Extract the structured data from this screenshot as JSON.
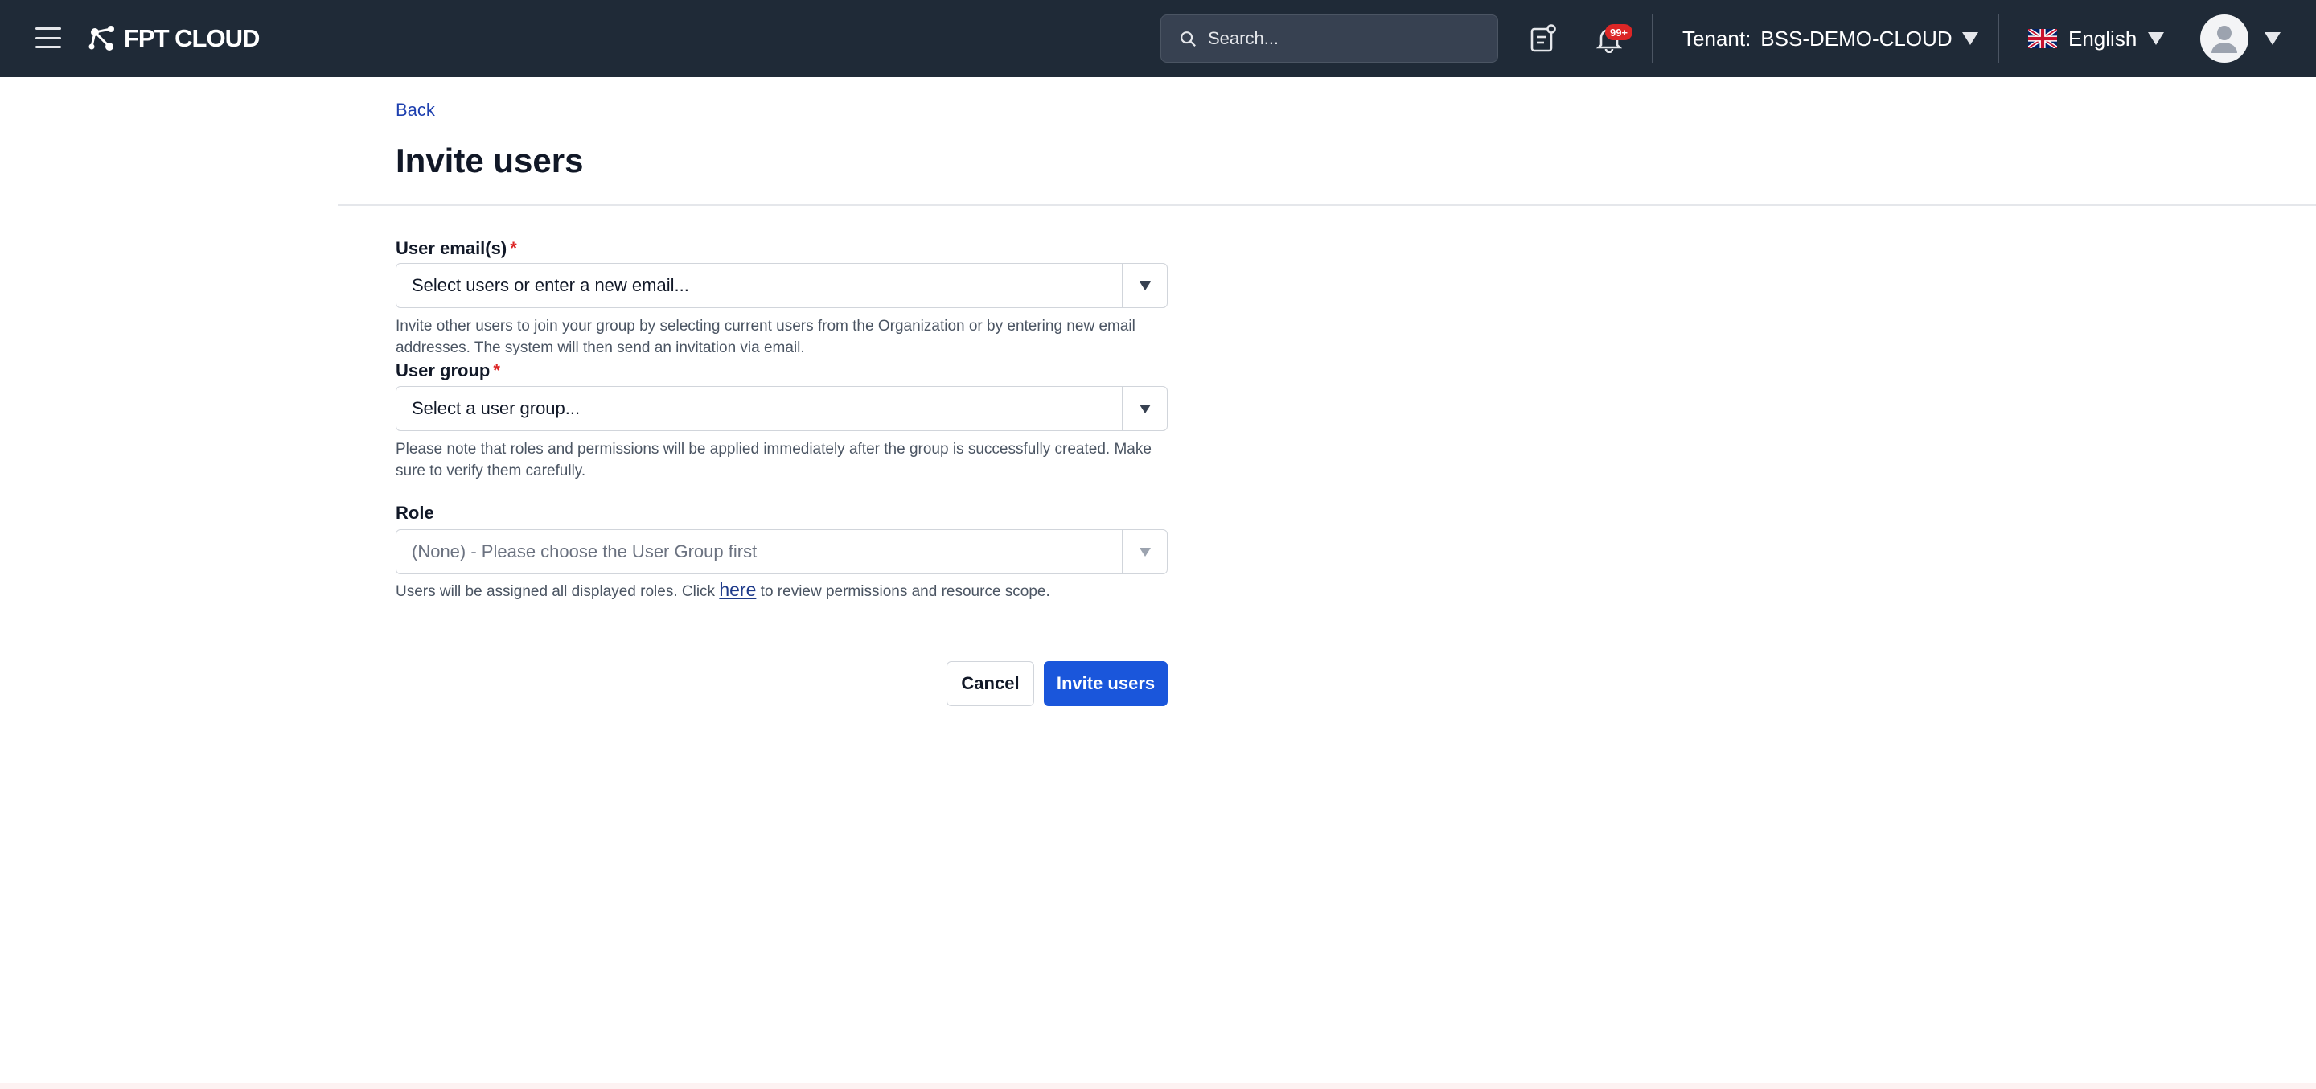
{
  "topbar": {
    "logo_text": "FPT CLOUD",
    "search_placeholder": "Search...",
    "notification_badge": "99+",
    "tenant_label": "Tenant:",
    "tenant_value": "BSS-DEMO-CLOUD",
    "language": "English",
    "icons": [
      "menu-icon",
      "search-icon",
      "document-icon",
      "bell-icon",
      "uk-flag-icon",
      "user-avatar-icon"
    ]
  },
  "page": {
    "back_label": "Back",
    "title": "Invite users"
  },
  "form": {
    "email": {
      "label": "User email(s)",
      "required_mark": "*",
      "placeholder": "Select users or enter a new email...",
      "help": "Invite other users to join your group by selecting current users from the Organization or by entering new email addresses. The system will then send an invitation via email."
    },
    "group": {
      "label": "User group",
      "required_mark": "*",
      "placeholder": "Select a user group...",
      "help": "Please note that roles and permissions will be applied immediately after the group is successfully created. Make sure to verify them carefully."
    },
    "role": {
      "label": "Role",
      "placeholder": "(None) - Please choose the User Group first",
      "help_before": "Users will be assigned all displayed roles. Click ",
      "help_link": "here",
      "help_after": " to review permissions and resource scope."
    },
    "cancel_label": "Cancel",
    "submit_label": "Invite users"
  },
  "colors": {
    "topbar_bg": "#1f2a37",
    "primary": "#1a56db",
    "required": "#dc2626",
    "link": "#1e40af"
  }
}
